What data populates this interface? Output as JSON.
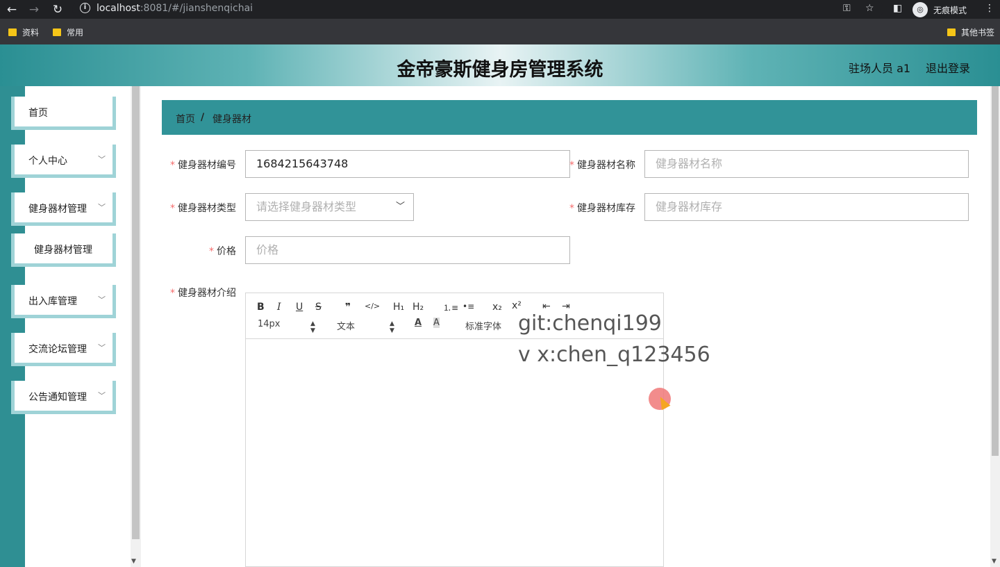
{
  "browser": {
    "url_host": "localhost",
    "url_rest": ":8081/#/jianshenqichai",
    "incognito_label": "无痕模式",
    "bookmarks": [
      "资料",
      "常用"
    ],
    "other_bookmarks": "其他书签"
  },
  "header": {
    "title": "金帝豪斯健身房管理系统",
    "user": "驻场人员 a1",
    "logout": "退出登录"
  },
  "sidebar": {
    "items": [
      {
        "label": "首页"
      },
      {
        "label": "个人中心"
      },
      {
        "label": "健身器材管理"
      },
      {
        "label": "健身器材管理"
      },
      {
        "label": "出入库管理"
      },
      {
        "label": "交流论坛管理"
      },
      {
        "label": "公告通知管理"
      }
    ]
  },
  "breadcrumb": {
    "home": "首页",
    "separator": "/",
    "current": "健身器材"
  },
  "form": {
    "code_label": "健身器材编号",
    "code_value": "1684215643748",
    "name_label": "健身器材名称",
    "name_placeholder": "健身器材名称",
    "type_label": "健身器材类型",
    "type_placeholder": "请选择健身器材类型",
    "stock_label": "健身器材库存",
    "stock_placeholder": "健身器材库存",
    "price_label": "价格",
    "price_placeholder": "价格",
    "intro_label": "健身器材介绍",
    "required_mark": "*"
  },
  "editor": {
    "bold": "B",
    "italic": "I",
    "underline": "U",
    "strike": "S",
    "quote": "❞",
    "code": "</>",
    "h1": "H₁",
    "h2": "H₂",
    "ordered_list": "⒈≡",
    "bullet_list": "•≡",
    "subscript": "x₂",
    "superscript": "x²",
    "outdent": "⇤",
    "indent": "⇥",
    "font_size": "14px",
    "header_style": "文本",
    "font_family": "标准字体"
  },
  "watermark": {
    "line1": "git:chenqi199",
    "line2": "v x:chen_q123456"
  }
}
